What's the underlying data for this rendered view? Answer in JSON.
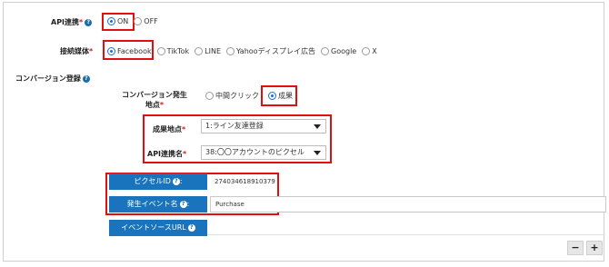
{
  "api_link": {
    "label": "API連携",
    "required_mark": "*",
    "options": [
      {
        "label": "ON",
        "selected": true
      },
      {
        "label": "OFF",
        "selected": false
      }
    ]
  },
  "media": {
    "label": "接続媒体",
    "required_mark": "*",
    "options": [
      {
        "label": "Facebook",
        "selected": true
      },
      {
        "label": "TikTok",
        "selected": false
      },
      {
        "label": "LINE",
        "selected": false
      },
      {
        "label": "Yahooディスプレイ広告",
        "selected": false
      },
      {
        "label": "Google",
        "selected": false
      },
      {
        "label": "X",
        "selected": false
      }
    ]
  },
  "conversion": {
    "section_label": "コンバージョン登録",
    "point_label_line1": "コンバージョン発生",
    "point_label_line2": "地点",
    "required_mark": "*",
    "point_options": [
      {
        "label": "中間クリック",
        "selected": false
      },
      {
        "label": "成果",
        "selected": true
      }
    ],
    "result_point": {
      "label": "成果地点",
      "value": "1:ライン友達登録"
    },
    "api_name": {
      "label": "API連携名",
      "value": "38:〇〇アカウントのピクセル"
    }
  },
  "pixel": {
    "pixel_id_label": "ピクセルID",
    "pixel_id_value": "274034618910379",
    "event_label": "発生イベント名",
    "event_value": "Purchase",
    "event_source_label": "イベントソースURL",
    "colon": ":"
  },
  "buttons": {
    "minus": "−",
    "plus": "+"
  },
  "icons": {
    "help": "?"
  },
  "colors": {
    "accent": "#1a74bd",
    "highlight": "#e01010",
    "radio": "#1a6fd0"
  }
}
